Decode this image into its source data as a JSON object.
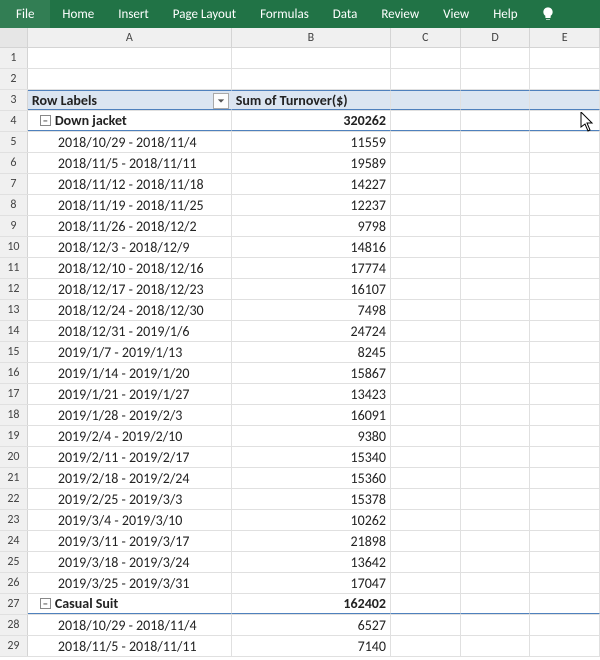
{
  "ribbon": {
    "file": "File",
    "tabs": [
      "Home",
      "Insert",
      "Page Layout",
      "Formulas",
      "Data",
      "Review",
      "View",
      "Help"
    ]
  },
  "columns": [
    "A",
    "B",
    "C",
    "D",
    "E"
  ],
  "pivot_header": {
    "row_labels": "Row Labels",
    "sum_label": "Sum of Turnover($)"
  },
  "rows": [
    {
      "num": 1,
      "kind": "blank"
    },
    {
      "num": 2,
      "kind": "blank"
    },
    {
      "num": 3,
      "kind": "pivot_header"
    },
    {
      "num": 4,
      "kind": "group",
      "label": "Down jacket",
      "value": "320262"
    },
    {
      "num": 5,
      "kind": "data",
      "label": "2018/10/29 - 2018/11/4",
      "value": "11559"
    },
    {
      "num": 6,
      "kind": "data",
      "label": "2018/11/5 - 2018/11/11",
      "value": "19589"
    },
    {
      "num": 7,
      "kind": "data",
      "label": "2018/11/12 - 2018/11/18",
      "value": "14227"
    },
    {
      "num": 8,
      "kind": "data",
      "label": "2018/11/19 - 2018/11/25",
      "value": "12237"
    },
    {
      "num": 9,
      "kind": "data",
      "label": "2018/11/26 - 2018/12/2",
      "value": "9798"
    },
    {
      "num": 10,
      "kind": "data",
      "label": "2018/12/3 - 2018/12/9",
      "value": "14816"
    },
    {
      "num": 11,
      "kind": "data",
      "label": "2018/12/10 - 2018/12/16",
      "value": "17774"
    },
    {
      "num": 12,
      "kind": "data",
      "label": "2018/12/17 - 2018/12/23",
      "value": "16107"
    },
    {
      "num": 13,
      "kind": "data",
      "label": "2018/12/24 - 2018/12/30",
      "value": "7498"
    },
    {
      "num": 14,
      "kind": "data",
      "label": "2018/12/31 - 2019/1/6",
      "value": "24724"
    },
    {
      "num": 15,
      "kind": "data",
      "label": "2019/1/7 - 2019/1/13",
      "value": "8245"
    },
    {
      "num": 16,
      "kind": "data",
      "label": "2019/1/14 - 2019/1/20",
      "value": "15867"
    },
    {
      "num": 17,
      "kind": "data",
      "label": "2019/1/21 - 2019/1/27",
      "value": "13423"
    },
    {
      "num": 18,
      "kind": "data",
      "label": "2019/1/28 - 2019/2/3",
      "value": "16091"
    },
    {
      "num": 19,
      "kind": "data",
      "label": "2019/2/4 - 2019/2/10",
      "value": "9380"
    },
    {
      "num": 20,
      "kind": "data",
      "label": "2019/2/11 - 2019/2/17",
      "value": "15340"
    },
    {
      "num": 21,
      "kind": "data",
      "label": "2019/2/18 - 2019/2/24",
      "value": "15360"
    },
    {
      "num": 22,
      "kind": "data",
      "label": "2019/2/25 - 2019/3/3",
      "value": "15378"
    },
    {
      "num": 23,
      "kind": "data",
      "label": "2019/3/4 - 2019/3/10",
      "value": "10262"
    },
    {
      "num": 24,
      "kind": "data",
      "label": "2019/3/11 - 2019/3/17",
      "value": "21898"
    },
    {
      "num": 25,
      "kind": "data",
      "label": "2019/3/18 - 2019/3/24",
      "value": "13642"
    },
    {
      "num": 26,
      "kind": "data",
      "label": "2019/3/25 - 2019/3/31",
      "value": "17047"
    },
    {
      "num": 27,
      "kind": "group",
      "label": "Casual Suit",
      "value": "162402"
    },
    {
      "num": 28,
      "kind": "data",
      "label": "2018/10/29 - 2018/11/4",
      "value": "6527"
    },
    {
      "num": 29,
      "kind": "data",
      "label": "2018/11/5 - 2018/11/11",
      "value": "7140"
    }
  ],
  "collapse_glyph": "−"
}
